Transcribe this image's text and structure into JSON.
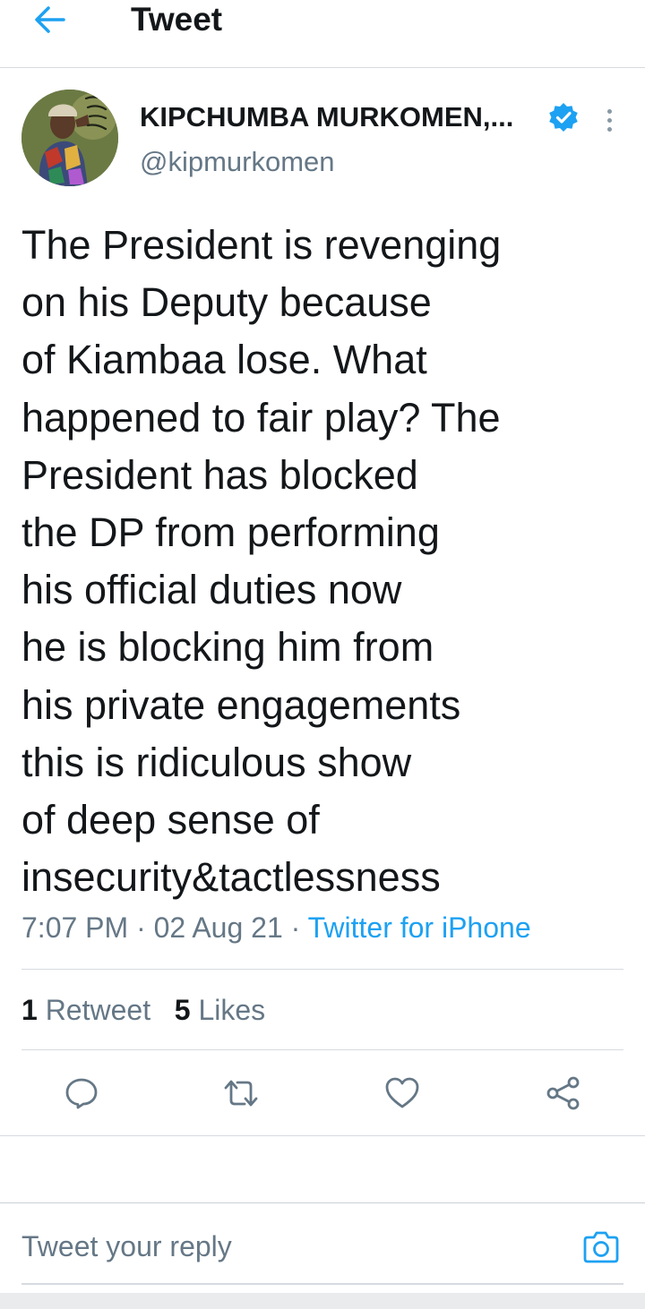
{
  "colors": {
    "accent": "#1da1f2",
    "text_primary": "#14171a",
    "text_secondary": "#657786",
    "divider": "#d6dbe0"
  },
  "header": {
    "back_icon": "arrow-left-icon",
    "title": "Tweet"
  },
  "author": {
    "name": "KIPCHUMBA MURKOMEN,...",
    "handle": "@kipmurkomen",
    "verified_icon": "verified-badge-icon",
    "more_icon": "more-vertical-icon"
  },
  "tweet": {
    "lines": [
      "The President is revenging",
      "on his Deputy because",
      "of Kiambaa lose. What",
      "happened to fair play? The",
      "President has blocked",
      "the DP from performing",
      "his official duties now",
      "he is blocking him from",
      "his private engagements",
      "this is ridiculous show",
      "of deep sense of",
      "insecurity&tactlessness"
    ],
    "time": "7:07 PM",
    "separator": "·",
    "date": "02 Aug 21",
    "source": "Twitter for iPhone"
  },
  "stats": {
    "retweet_count": "1",
    "retweet_label": "Retweet",
    "like_count": "5",
    "like_label": "Likes"
  },
  "actions": [
    {
      "icon": "reply-icon"
    },
    {
      "icon": "retweet-icon"
    },
    {
      "icon": "like-heart-icon"
    },
    {
      "icon": "share-icon"
    }
  ],
  "reply": {
    "placeholder": "Tweet your reply",
    "camera_icon": "camera-icon"
  }
}
